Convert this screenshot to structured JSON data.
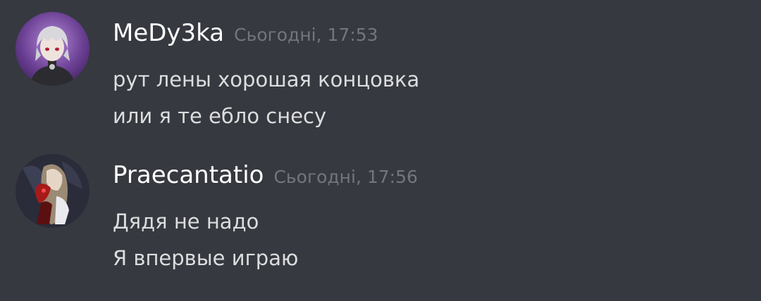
{
  "messages": [
    {
      "author": "MeDy3ka",
      "timestamp": "Сьогодні, 17:53",
      "avatar_icon": "anime-avatar-icon",
      "lines": [
        "рут лены хорошая концовка",
        "или я те ебло снесу"
      ]
    },
    {
      "author": "Praecantatio",
      "timestamp": "Сьогодні, 17:56",
      "avatar_icon": "anime-avatar-icon",
      "lines": [
        "Дядя не надо",
        "Я впервые играю"
      ]
    }
  ],
  "colors": {
    "background": "#36393f",
    "author": "#ffffff",
    "timestamp": "#72767d",
    "message_text": "#dcddde"
  }
}
